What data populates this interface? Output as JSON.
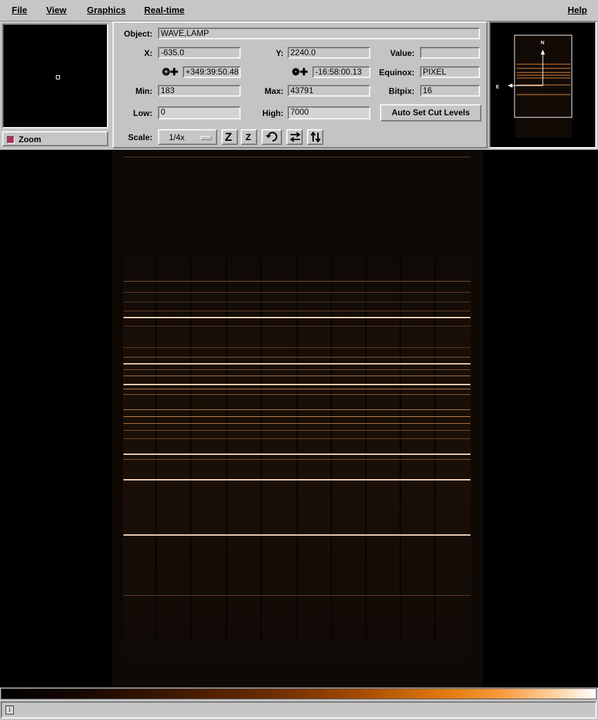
{
  "menu": {
    "file": "File",
    "view": "View",
    "graphics": "Graphics",
    "realtime": "Real-time",
    "help": "Help"
  },
  "zoom": {
    "label": "Zoom",
    "checked": true
  },
  "info": {
    "object_label": "Object:",
    "object_value": "WAVE,LAMP",
    "x_label": "X:",
    "x_value": "-635.0",
    "y_label": "Y:",
    "y_value": "2240.0",
    "value_label": "Value:",
    "value_value": "",
    "ra_value": "+349:39:50.48",
    "dec_value": "-16:58:00.13",
    "equinox_label": "Equinox:",
    "equinox_value": "PIXEL",
    "min_label": "Min:",
    "min_value": "183",
    "max_label": "Max:",
    "max_value": "43791",
    "bitpix_label": "Bitpix:",
    "bitpix_value": "16",
    "low_label": "Low:",
    "low_value": "0",
    "high_label": "High:",
    "high_value": "7000",
    "autocut_label": "Auto Set Cut Levels",
    "scale_label": "Scale:",
    "scale_value": "1/4x"
  },
  "toolbar_icons": [
    "zoom-in-icon",
    "zoom-out-icon",
    "rotate-icon",
    "flip-x-icon",
    "flip-y-icon"
  ],
  "compass": {
    "north": "N",
    "east": "E"
  },
  "colors": {
    "colormap_low": "#000000",
    "colormap_mid": "#a34a00",
    "colormap_high": "#ffffff",
    "spectral_line": "#f0a060"
  },
  "status": {
    "icon": "i",
    "message": ""
  }
}
